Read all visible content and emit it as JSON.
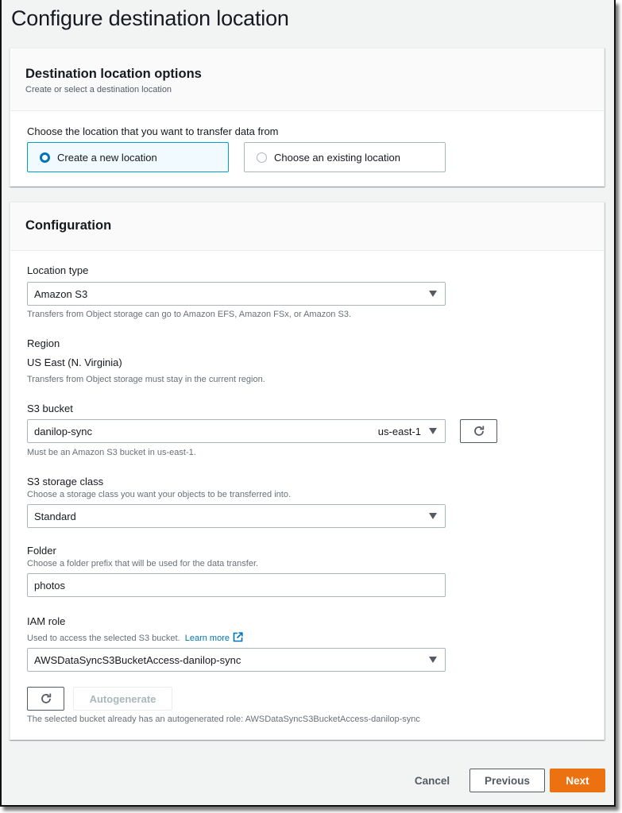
{
  "page": {
    "title": "Configure destination location"
  },
  "destination_options": {
    "title": "Destination location options",
    "description": "Create or select a destination location",
    "question": "Choose the location that you want to transfer data from",
    "choices": [
      {
        "label": "Create a new location",
        "selected": true
      },
      {
        "label": "Choose an existing location",
        "selected": false
      }
    ]
  },
  "configuration": {
    "title": "Configuration",
    "location_type": {
      "label": "Location type",
      "value": "Amazon S3",
      "hint": "Transfers from Object storage can go to Amazon EFS, Amazon FSx, or Amazon S3."
    },
    "region": {
      "label": "Region",
      "value": "US East (N. Virginia)",
      "hint": "Transfers from Object storage must stay in the current region."
    },
    "s3_bucket": {
      "label": "S3 bucket",
      "value": "danilop-sync",
      "region_tag": "us-east-1",
      "hint": "Must be an Amazon S3 bucket in us-east-1.",
      "refresh_icon": "refresh-icon"
    },
    "storage_class": {
      "label": "S3 storage class",
      "description": "Choose a storage class you want your objects to be transferred into.",
      "value": "Standard"
    },
    "folder": {
      "label": "Folder",
      "description": "Choose a folder prefix that will be used for the data transfer.",
      "value": "photos"
    },
    "iam_role": {
      "label": "IAM role",
      "description": "Used to access the selected S3 bucket.",
      "learn_more": "Learn more",
      "value": "AWSDataSyncS3BucketAccess-danilop-sync",
      "autogenerate_label": "Autogenerate",
      "hint": "The selected bucket already has an autogenerated role: AWSDataSyncS3BucketAccess-danilop-sync"
    }
  },
  "footer": {
    "cancel": "Cancel",
    "previous": "Previous",
    "next": "Next"
  },
  "colors": {
    "accent_primary": "#ec7211",
    "link": "#0073bb",
    "selected_tile_bg": "#f1faff",
    "selected_tile_border": "#00a1c9"
  }
}
